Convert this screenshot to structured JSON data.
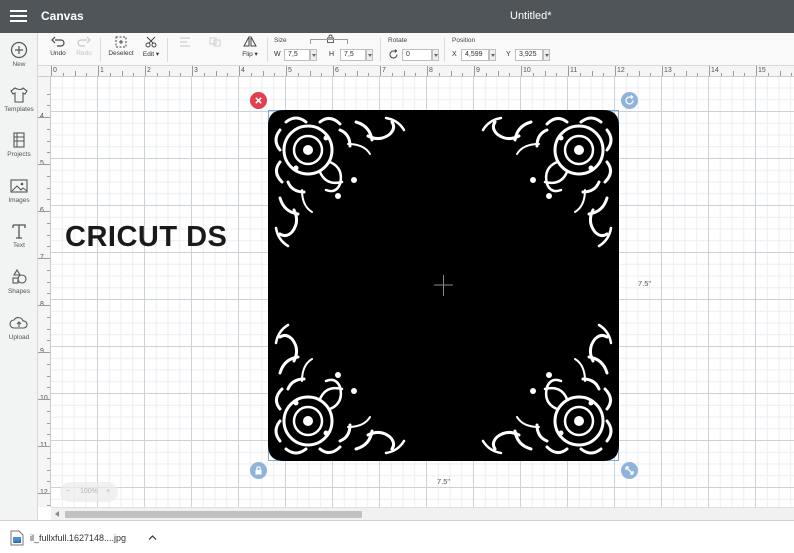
{
  "header": {
    "app_title": "Canvas",
    "doc_title": "Untitled*"
  },
  "sidebar": {
    "items": [
      {
        "label": "New",
        "icon": "plus-circle-icon"
      },
      {
        "label": "Templates",
        "icon": "shirt-icon"
      },
      {
        "label": "Projects",
        "icon": "projects-icon"
      },
      {
        "label": "Images",
        "icon": "image-icon"
      },
      {
        "label": "Text",
        "icon": "text-icon"
      },
      {
        "label": "Shapes",
        "icon": "shapes-icon"
      },
      {
        "label": "Upload",
        "icon": "cloud-upload-icon"
      }
    ]
  },
  "toolbar": {
    "undo": "Undo",
    "redo": "Redo",
    "deselect": "Deselect",
    "edit": "Edit",
    "flip": "Flip",
    "size": {
      "label": "Size",
      "w_label": "W",
      "w_value": "7,5",
      "h_label": "H",
      "h_value": "7,5"
    },
    "rotate": {
      "label": "Rotate",
      "value": "0"
    },
    "position": {
      "label": "Position",
      "x_label": "X",
      "x_value": "4,599",
      "y_label": "Y",
      "y_value": "3,925"
    }
  },
  "ruler": {
    "top": [
      "0",
      "1",
      "2",
      "3",
      "4",
      "5",
      "6",
      "7",
      "8",
      "9",
      "10",
      "11",
      "12",
      "13",
      "14",
      "15"
    ],
    "left": [
      "4",
      "5",
      "6",
      "7",
      "8",
      "9",
      "10",
      "11",
      "12"
    ]
  },
  "canvas": {
    "overlay_text": "CRICUT DS",
    "width_label": "7.5\"",
    "height_label": "7.5\"",
    "zoom": "100%"
  },
  "downloads": {
    "file_name": "il_fullxfull.1627148....jpg"
  },
  "colors": {
    "header": "#505559",
    "delete_handle": "#e0404f",
    "handle": "#8fb3d9",
    "design_fill": "#000000"
  }
}
